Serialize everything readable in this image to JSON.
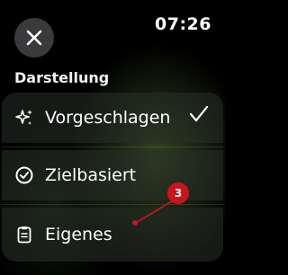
{
  "status": {
    "time": "07:26"
  },
  "header": {
    "close_icon": "close-x-icon"
  },
  "section": {
    "title": "Darstellung"
  },
  "options": [
    {
      "label": "Vorgeschlagen",
      "icon": "sparkles-icon",
      "selected": true
    },
    {
      "label": "Zielbasiert",
      "icon": "checkmark-circle-icon",
      "selected": false
    },
    {
      "label": "Eigenes",
      "icon": "clipboard-icon",
      "selected": false
    }
  ],
  "annotation": {
    "badge": "3",
    "color": "#c8141e"
  }
}
